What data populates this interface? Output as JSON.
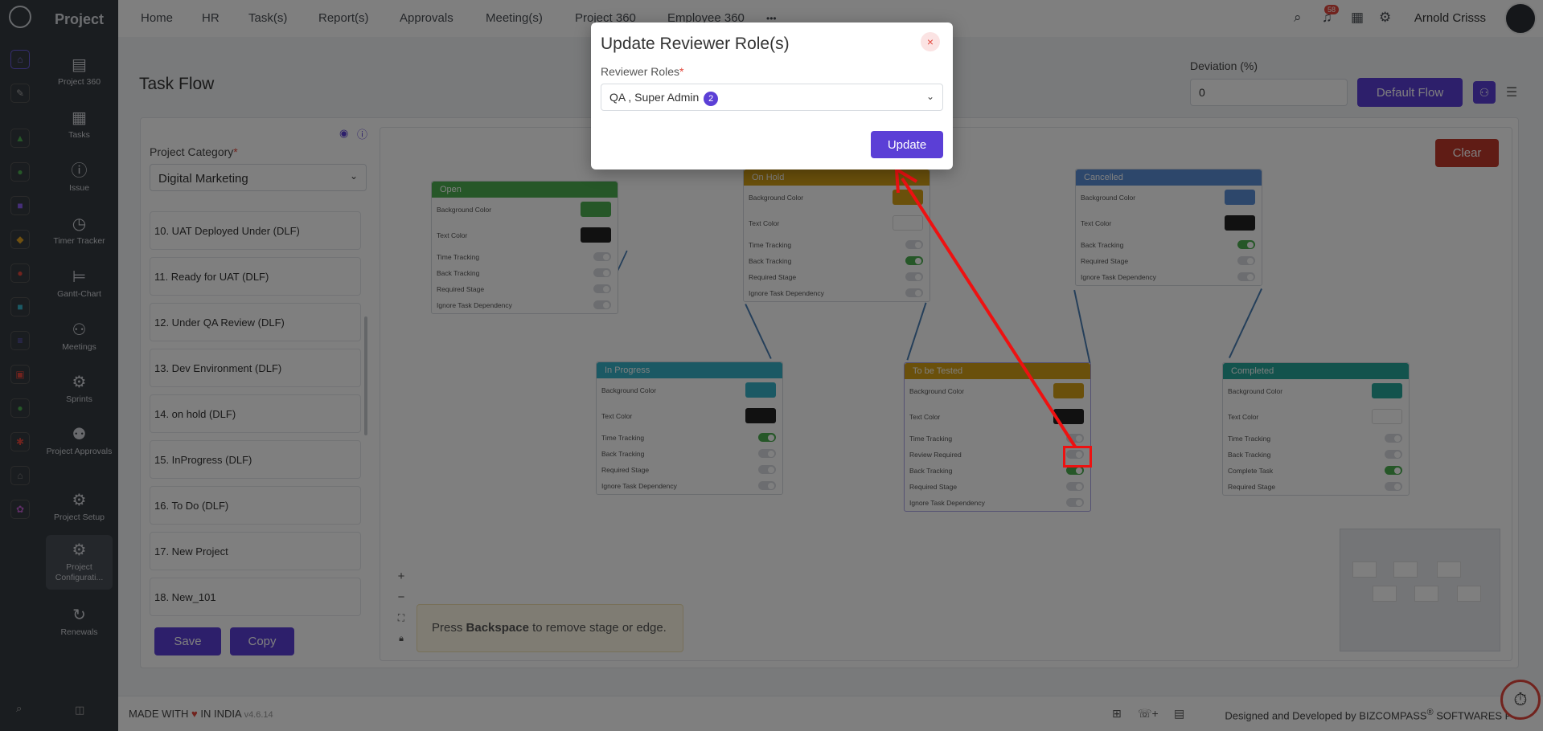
{
  "app": {
    "name": "Project"
  },
  "header": {
    "menu": [
      "Home",
      "HR",
      "Task(s)",
      "Report(s)",
      "Approvals",
      "Meeting(s)",
      "Project 360",
      "Employee 360"
    ],
    "more": "•••",
    "notification_count": "58",
    "user_name": "Arnold Crisss"
  },
  "sidebar": {
    "items": [
      {
        "label": "Project 360",
        "icon": "briefcase-icon"
      },
      {
        "label": "Tasks",
        "icon": "clipboard-icon"
      },
      {
        "label": "Issue",
        "icon": "alert-icon"
      },
      {
        "label": "Timer Tracker",
        "icon": "clock-icon"
      },
      {
        "label": "Gantt-Chart",
        "icon": "gantt-icon"
      },
      {
        "label": "Meetings",
        "icon": "meetings-icon"
      },
      {
        "label": "Sprints",
        "icon": "gear-icon"
      },
      {
        "label": "Project Approvals",
        "icon": "user-gear-icon"
      },
      {
        "label": "Project Setup",
        "icon": "gear-icon"
      },
      {
        "label": "Project Configurati...",
        "icon": "gear-icon"
      },
      {
        "label": "Renewals",
        "icon": "refresh-icon"
      }
    ]
  },
  "page": {
    "title": "Task Flow",
    "deviation_label": "Deviation (%)",
    "deviation_value": "0",
    "default_flow_label": "Default Flow",
    "clear_label": "Clear",
    "project_category_label": "Project Category",
    "project_category_value": "Digital Marketing",
    "stages": [
      "10. UAT Deployed Under (DLF)",
      "11. Ready for UAT (DLF)",
      "12. Under QA Review (DLF)",
      "13. Dev Environment (DLF)",
      "14. on hold (DLF)",
      "15. InProgress (DLF)",
      "16. To Do (DLF)",
      "17. New Project",
      "18. New_101"
    ],
    "save_label": "Save",
    "copy_label": "Copy",
    "hint_prefix": "Press ",
    "hint_key": "Backspace",
    "hint_suffix": " to remove stage or edge."
  },
  "nodes": {
    "open": {
      "title": "Open",
      "header_color": "#4caf50",
      "bg": "Background Color",
      "text": "Text Color",
      "r1": "Time Tracking",
      "r2": "Back Tracking",
      "r3": "Required Stage",
      "r4": "Ignore Task Dependency"
    },
    "onhold": {
      "title": "On Hold",
      "header_color": "#d4a017",
      "bg": "Background Color",
      "text": "Text Color",
      "r1": "Time Tracking",
      "r2": "Back Tracking",
      "r3": "Required Stage",
      "r4": "Ignore Task Dependency"
    },
    "cancelled": {
      "title": "Cancelled",
      "header_color": "#5b8fd6",
      "bg": "Background Color",
      "text": "Text Color",
      "r1": "Back Tracking",
      "r2": "Required Stage",
      "r3": "Ignore Task Dependency"
    },
    "inprogress": {
      "title": "In Progress",
      "header_color": "#36b3c9",
      "bg": "Background Color",
      "text": "Text Color",
      "r1": "Time Tracking",
      "r2": "Back Tracking",
      "r3": "Required Stage",
      "r4": "Ignore Task Dependency"
    },
    "tobetested": {
      "title": "To be Tested",
      "header_color": "#d4a017",
      "bg": "Background Color",
      "text": "Text Color",
      "r1": "Time Tracking",
      "r2": "Review Required",
      "r3": "Back Tracking",
      "r4": "Required Stage",
      "r5": "Ignore Task Dependency"
    },
    "completed": {
      "title": "Completed",
      "header_color": "#26a69a",
      "bg": "Background Color",
      "text": "Text Color",
      "r1": "Time Tracking",
      "r2": "Back Tracking",
      "r3": "Complete Task",
      "r4": "Required Stage"
    }
  },
  "footer": {
    "made_with": "MADE WITH",
    "heart": "♥",
    "in_india": "IN INDIA",
    "version": "v4.6.14",
    "designed_by": "Designed and Developed by",
    "company": "BIZCOMPASS",
    "reg": "®",
    "company_suffix": "SOFTWARES PV"
  },
  "modal": {
    "title": "Update Reviewer Role(s)",
    "close": "×",
    "field_label": "Reviewer Roles",
    "required_mark": "*",
    "selected_value": "QA , Super Admin",
    "selected_count": "2",
    "update_label": "Update"
  },
  "colors": {
    "accent": "#5b3fd6",
    "danger": "#c0392b",
    "sidebar": "#343a40"
  }
}
